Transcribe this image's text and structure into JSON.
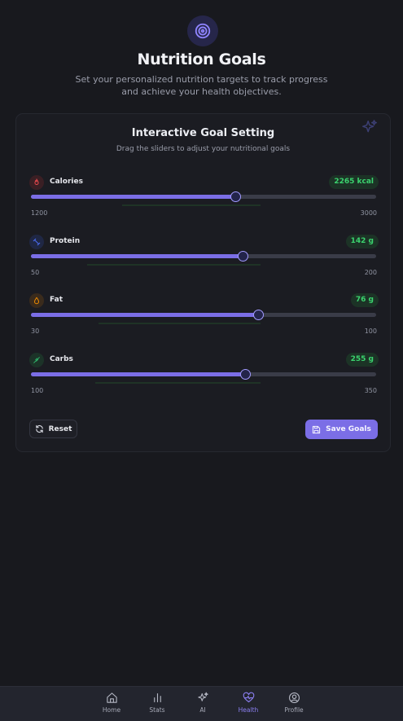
{
  "header": {
    "icon": "target-icon",
    "title": "Nutrition Goals",
    "subtitle": "Set your personalized nutrition targets to track progress and achieve your health objectives."
  },
  "card": {
    "title": "Interactive Goal Setting",
    "subtitle": "Drag the sliders to adjust your nutritional goals",
    "decoration_icon": "sparkles-icon"
  },
  "goals": [
    {
      "label": "Calories",
      "value_text": "2265 kcal",
      "value": 2265,
      "min": 1200,
      "max": 3000,
      "min_label": "1200",
      "max_label": "3000",
      "icon": "flame-icon",
      "color": "#e5484d"
    },
    {
      "label": "Protein",
      "value_text": "142 g",
      "value": 142,
      "min": 50,
      "max": 200,
      "min_label": "50",
      "max_label": "200",
      "icon": "dumbbell-icon",
      "color": "#4c6ef5"
    },
    {
      "label": "Fat",
      "value_text": "76 g",
      "value": 76,
      "min": 30,
      "max": 100,
      "min_label": "30",
      "max_label": "100",
      "icon": "droplet-icon",
      "color": "#f08c00"
    },
    {
      "label": "Carbs",
      "value_text": "255 g",
      "value": 255,
      "min": 100,
      "max": 350,
      "min_label": "100",
      "max_label": "350",
      "icon": "wheat-icon",
      "color": "#2fb36a"
    }
  ],
  "actions": {
    "reset_label": "Reset",
    "save_label": "Save Goals"
  },
  "nav": {
    "items": [
      {
        "label": "Home",
        "icon": "home-icon",
        "active": false
      },
      {
        "label": "Stats",
        "icon": "bar-chart-icon",
        "active": false
      },
      {
        "label": "AI",
        "icon": "sparkles-icon",
        "active": false
      },
      {
        "label": "Health",
        "icon": "heart-pulse-icon",
        "active": true
      },
      {
        "label": "Profile",
        "icon": "user-circle-icon",
        "active": false
      }
    ]
  },
  "colors": {
    "accent": "#7b6ee6",
    "success": "#3bd36e",
    "background": "#18191e"
  }
}
